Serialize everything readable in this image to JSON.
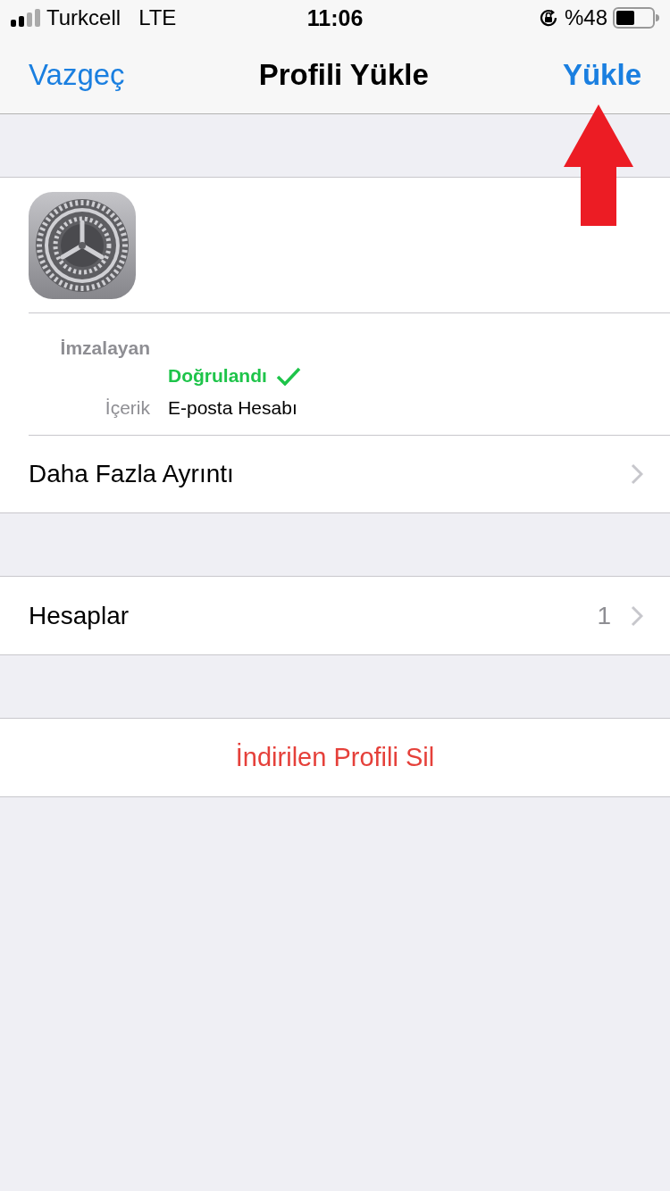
{
  "status_bar": {
    "carrier": "Turkcell",
    "network": "LTE",
    "time": "11:06",
    "battery": "%48"
  },
  "nav": {
    "cancel": "Vazgeç",
    "title": "Profili Yükle",
    "install": "Yükle"
  },
  "profile": {
    "signer_label": "İmzalayan",
    "verified": "Doğrulandı",
    "content_label": "İçerik",
    "content_value": "E-posta Hesabı"
  },
  "rows": [
    {
      "label": "Daha Fazla Ayrıntı"
    },
    {
      "label": "Hesaplar",
      "value": "1"
    }
  ],
  "delete_button": "İndirilen Profili Sil"
}
